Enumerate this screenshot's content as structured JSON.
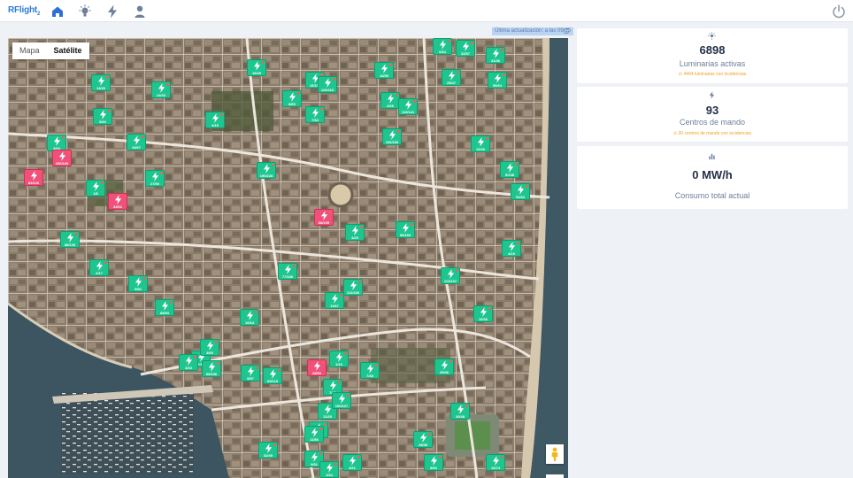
{
  "topbar": {
    "logo": "RFlight",
    "logo_sub": "2",
    "nav": [
      "home-icon",
      "bulb-icon",
      "bolt-icon",
      "user-icon"
    ],
    "power": "power-icon"
  },
  "map": {
    "updated_text": "Última actualización: a las 09:15",
    "toggle": {
      "map_label": "Mapa",
      "satellite_label": "Satélite",
      "selected": "Satélite"
    },
    "markers": [
      {
        "label": "6/34",
        "alert": false
      },
      {
        "label": "32/57",
        "alert": false
      },
      {
        "label": "31/36",
        "alert": false
      },
      {
        "label": "16/39",
        "alert": false
      },
      {
        "label": "10/50",
        "alert": false
      },
      {
        "label": "25/47",
        "alert": false
      },
      {
        "label": "14/26",
        "alert": false
      },
      {
        "label": "24/43",
        "alert": false
      },
      {
        "label": "16/158",
        "alert": false
      },
      {
        "label": "110/210",
        "alert": false
      },
      {
        "label": "56/64",
        "alert": false
      },
      {
        "label": "8/69",
        "alert": false
      },
      {
        "label": "2/26",
        "alert": false
      },
      {
        "label": "119/141",
        "alert": false
      },
      {
        "label": "7/34",
        "alert": false
      },
      {
        "label": "9/34",
        "alert": false
      },
      {
        "label": "4/15",
        "alert": false
      },
      {
        "label": "106/160",
        "alert": false
      },
      {
        "label": "10/40",
        "alert": false
      },
      {
        "label": "3/34",
        "alert": false
      },
      {
        "label": "16/67",
        "alert": false
      },
      {
        "label": "100/160",
        "alert": true
      },
      {
        "label": "83/126",
        "alert": true
      },
      {
        "label": "27/50",
        "alert": false
      },
      {
        "label": "33/61",
        "alert": true
      },
      {
        "label": "190/228",
        "alert": false
      },
      {
        "label": "5/138",
        "alert": false
      },
      {
        "label": "51/84",
        "alert": false
      },
      {
        "label": "1/8",
        "alert": false
      },
      {
        "label": "88/199",
        "alert": true
      },
      {
        "label": "4/25",
        "alert": false
      },
      {
        "label": "95/183",
        "alert": false
      },
      {
        "label": "88/130",
        "alert": false
      },
      {
        "label": "4/19",
        "alert": false
      },
      {
        "label": "2/17",
        "alert": false
      },
      {
        "label": "9/52",
        "alert": false
      },
      {
        "label": "77/180",
        "alert": false
      },
      {
        "label": "113/137",
        "alert": false
      },
      {
        "label": "11/67",
        "alert": false
      },
      {
        "label": "112/246",
        "alert": false
      },
      {
        "label": "85/93",
        "alert": false
      },
      {
        "label": "10/64",
        "alert": false
      },
      {
        "label": "10/36",
        "alert": false
      },
      {
        "label": "7/19",
        "alert": false
      },
      {
        "label": "3/65",
        "alert": false
      },
      {
        "label": "95/156",
        "alert": false
      },
      {
        "label": "3/15",
        "alert": false
      },
      {
        "label": "5/57",
        "alert": false
      },
      {
        "label": "1/16",
        "alert": false
      },
      {
        "label": "65/115",
        "alert": false
      },
      {
        "label": "35/50",
        "alert": true
      },
      {
        "label": "7/48",
        "alert": false
      },
      {
        "label": "25/46",
        "alert": false
      },
      {
        "label": "7/46",
        "alert": false
      },
      {
        "label": "20/48",
        "alert": false
      },
      {
        "label": "11/25",
        "alert": false
      },
      {
        "label": "100/127",
        "alert": false
      },
      {
        "label": "16/52",
        "alert": false
      },
      {
        "label": "11/56",
        "alert": false
      },
      {
        "label": "28/58",
        "alert": false
      },
      {
        "label": "32/49",
        "alert": false
      },
      {
        "label": "9/31",
        "alert": false
      },
      {
        "label": "4/21",
        "alert": false
      },
      {
        "label": "1/34",
        "alert": false
      },
      {
        "label": "8/54",
        "alert": false
      },
      {
        "label": "16/74",
        "alert": false
      }
    ]
  },
  "stats": {
    "lights": {
      "icon": "light-icon",
      "value": "6898",
      "caption": "Luminarias activas",
      "warning": "4494 luminarias con incidencias"
    },
    "controls": {
      "icon": "bolt-icon",
      "value": "93",
      "caption": "Centros de mando",
      "warning": "30 centros de mando con incidencias"
    },
    "consumption": {
      "icon": "chart-icon",
      "value": "0 MW/h",
      "caption": "Consumo total actual"
    }
  },
  "colors": {
    "marker_ok": "#1fc58e",
    "marker_alert": "#f0507a",
    "accent": "#2f6fd6",
    "warning": "#f0a020"
  }
}
